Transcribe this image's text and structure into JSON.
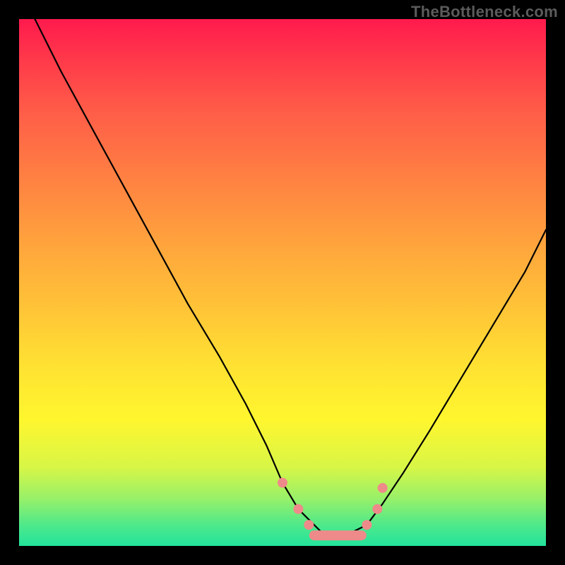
{
  "watermark": "TheBottleneck.com",
  "chart_data": {
    "type": "line",
    "title": "",
    "xlabel": "",
    "ylabel": "",
    "xlim": [
      0,
      100
    ],
    "ylim": [
      0,
      100
    ],
    "grid": false,
    "legend": false,
    "background_gradient": {
      "direction": "vertical",
      "stops": [
        {
          "pos": 0,
          "color": "#ff1a4d"
        },
        {
          "pos": 30,
          "color": "#ff8042"
        },
        {
          "pos": 66,
          "color": "#ffe232"
        },
        {
          "pos": 85,
          "color": "#d8f646"
        },
        {
          "pos": 100,
          "color": "#22e39c"
        }
      ]
    },
    "series": [
      {
        "name": "bottleneck-curve",
        "color": "#000000",
        "x": [
          3,
          8,
          14,
          20,
          26,
          32,
          38,
          43,
          47,
          50,
          53,
          56,
          58,
          62,
          66,
          69,
          73,
          78,
          84,
          90,
          96,
          100
        ],
        "y": [
          100,
          90,
          79,
          68,
          57,
          46,
          36,
          27,
          19,
          12,
          7,
          4,
          2,
          2,
          4,
          8,
          14,
          22,
          32,
          42,
          52,
          60
        ]
      }
    ],
    "markers": {
      "color": "#ef8a8a",
      "radius_px": 7,
      "points": [
        {
          "x": 50,
          "y": 12
        },
        {
          "x": 53,
          "y": 7
        },
        {
          "x": 55,
          "y": 4
        },
        {
          "x": 66,
          "y": 4
        },
        {
          "x": 68,
          "y": 7
        },
        {
          "x": 69,
          "y": 11
        }
      ],
      "flat_segment": {
        "x0": 56,
        "x1": 65,
        "y": 2
      }
    }
  }
}
